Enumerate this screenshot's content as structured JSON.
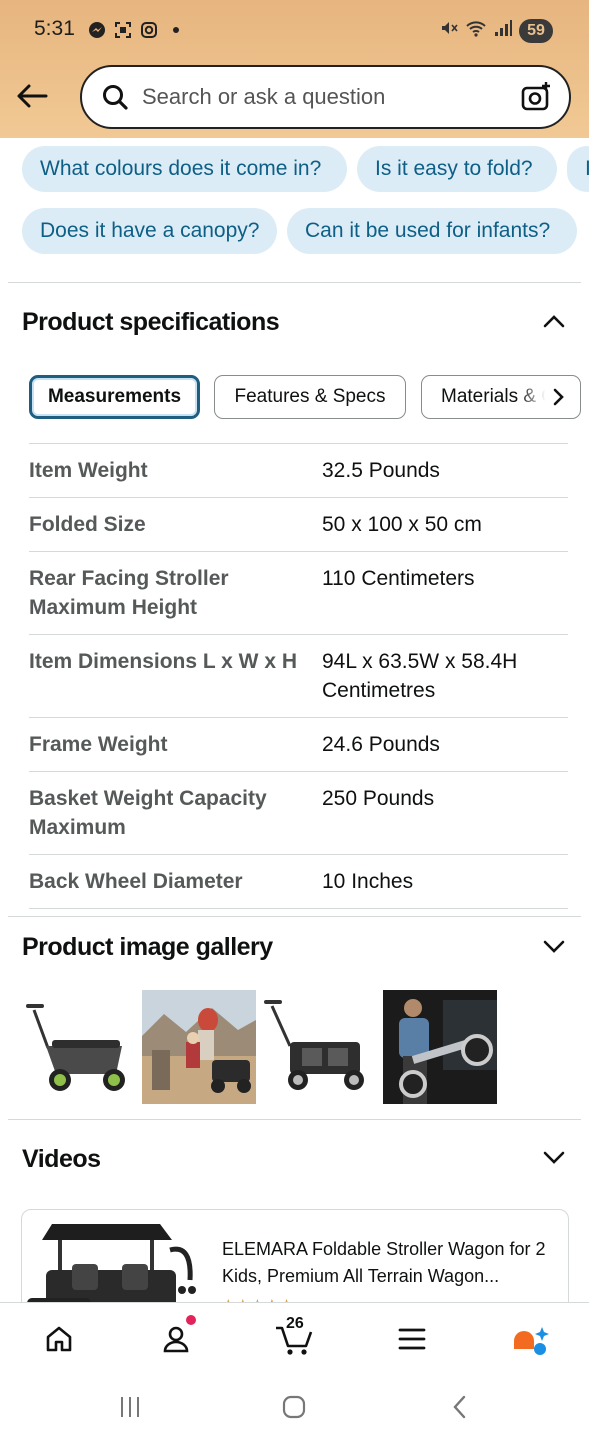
{
  "status_bar": {
    "time": "5:31",
    "battery": "59",
    "icons_left": [
      "messenger-icon",
      "screen-record-icon",
      "instagram-icon"
    ],
    "icons_right": [
      "mute-icon",
      "wifi-icon",
      "signal-icon"
    ]
  },
  "header": {
    "search_placeholder": "Search or ask a question",
    "back_icon": "arrow-left-icon",
    "camera_icon": "camera-lens-icon"
  },
  "questions": [
    "What colours does it come in?",
    "Is it easy to fold?",
    "I",
    "Does it have a canopy?",
    "Can it be used for infants?"
  ],
  "product_specifications": {
    "title": "Product specifications",
    "tabs": [
      "Measurements",
      "Features & Specs",
      "Materials & C"
    ],
    "active_tab": "Measurements",
    "rows": [
      {
        "label": "Item Weight",
        "value": "32.5 Pounds"
      },
      {
        "label": "Folded Size",
        "value": "50 x 100 x 50 cm"
      },
      {
        "label": "Rear Facing Stroller Maximum Height",
        "value": "110 Centimeters"
      },
      {
        "label": "Item Dimensions L x W x H",
        "value": "94L x 63.5W x 58.4H Centimetres"
      },
      {
        "label": "Frame Weight",
        "value": "24.6 Pounds"
      },
      {
        "label": "Basket Weight Capacity Maximum",
        "value": "250 Pounds"
      },
      {
        "label": "Back Wheel Diameter",
        "value": "10 Inches"
      }
    ]
  },
  "gallery": {
    "title": "Product image gallery",
    "thumbnails": [
      "stroller-wagon-side",
      "family-outdoors",
      "stroller-wagon-front",
      "man-loading-wagon"
    ]
  },
  "videos": {
    "title": "Videos",
    "card_title": "ELEMARA Foldable Stroller Wagon for 2 Kids, Premium All Terrain Wagon...",
    "stars": "★★★★★"
  },
  "bottom_nav": {
    "cart_count": "26",
    "items": [
      "home-icon",
      "account-icon",
      "cart-icon",
      "menu-icon",
      "rufus-icon"
    ]
  },
  "colors": {
    "header_bg": "#e7b57f",
    "chip_bg": "#dcecf7",
    "chip_text": "#0e5f85",
    "active_tab_border": "#1f5e80",
    "notification": "#e3245a",
    "rufus_orange": "#f26b21",
    "rufus_blue": "#1a8fe3"
  }
}
